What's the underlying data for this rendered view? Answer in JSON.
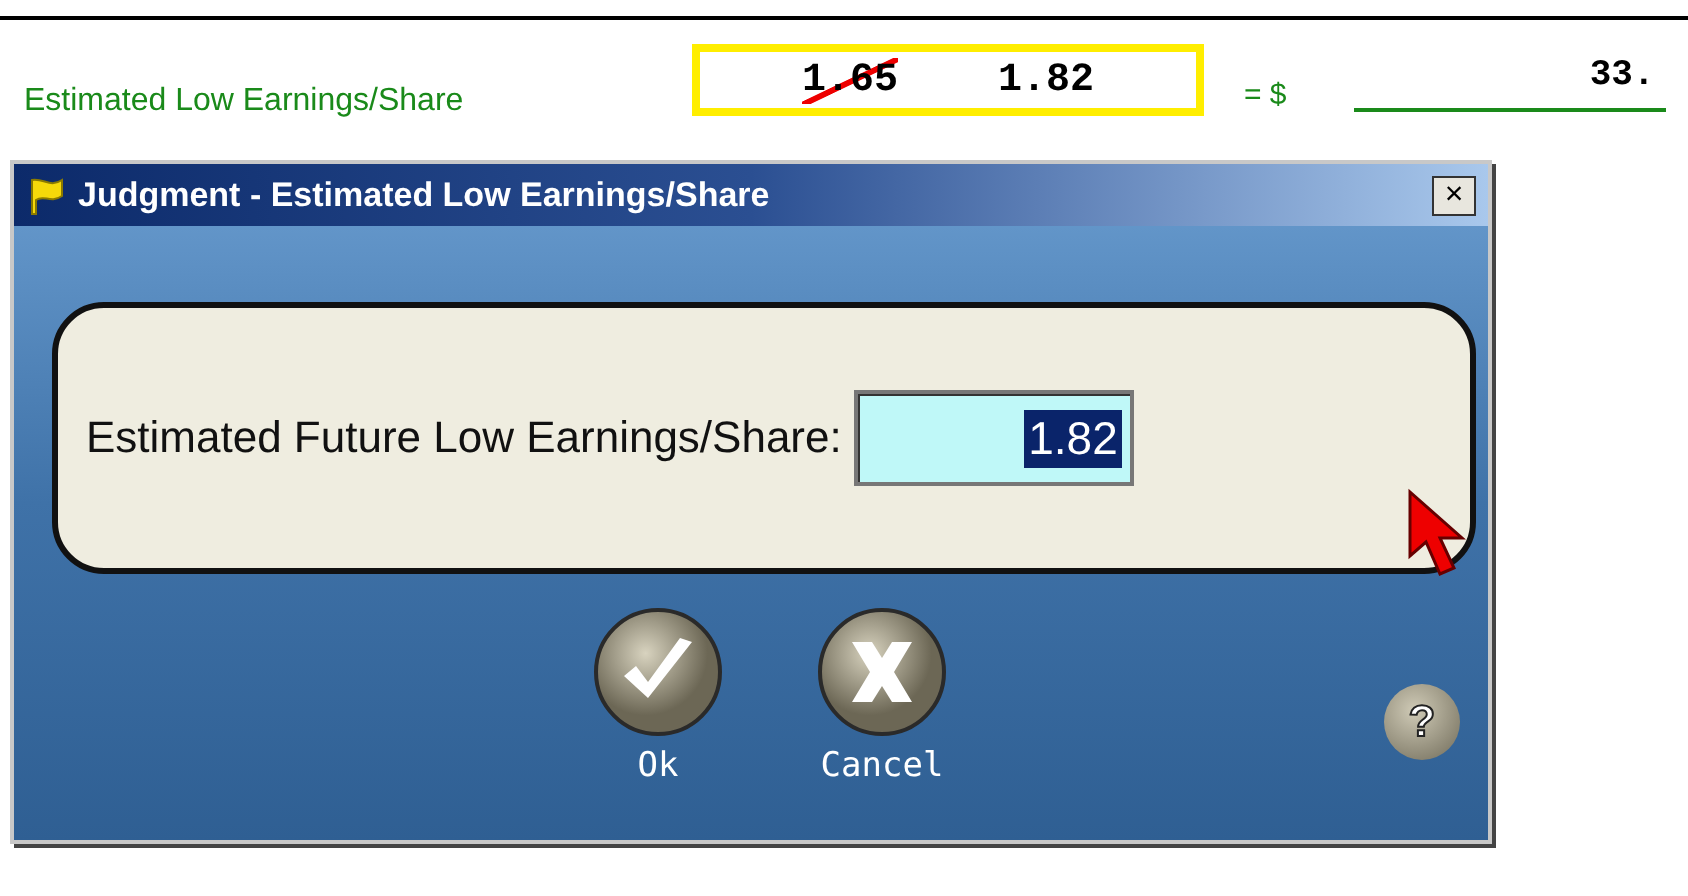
{
  "worksheet_row": {
    "label": "Estimated Low Earnings/Share",
    "values": [
      {
        "text": "1.65",
        "struck": true
      },
      {
        "text": "1.82",
        "struck": false
      }
    ],
    "equals": "= $",
    "result": "33."
  },
  "dialog": {
    "title": "Judgment - Estimated Low Earnings/Share",
    "close": "×",
    "field_label": "Estimated Future Low Earnings/Share:",
    "field_value": "1.82",
    "value_selected": true,
    "buttons": [
      {
        "kind": "ok",
        "label": "Ok"
      },
      {
        "kind": "cancel",
        "label": "Cancel"
      }
    ],
    "help": "?"
  }
}
